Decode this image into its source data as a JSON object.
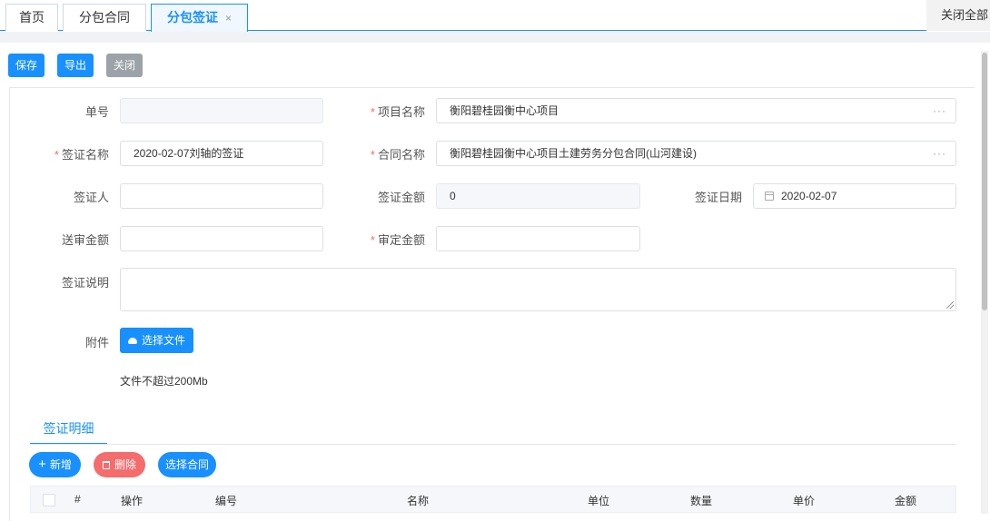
{
  "tabs": [
    {
      "label": "首页"
    },
    {
      "label": "分包合同"
    },
    {
      "label": "分包签证",
      "close": "×"
    }
  ],
  "close_all": "关闭全部",
  "toolbar": {
    "save": "保存",
    "export": "导出",
    "close": "关闭"
  },
  "form": {
    "order_no": {
      "label": "单号",
      "value": ""
    },
    "project_name": {
      "label": "项目名称",
      "required": "*",
      "value": "衡阳碧桂园衡中心项目",
      "more": "···"
    },
    "visa_name": {
      "label": "签证名称",
      "required": "*",
      "value": "2020-02-07刘轴的签证"
    },
    "contract_name": {
      "label": "合同名称",
      "required": "*",
      "value": "衡阳碧桂园衡中心项目土建劳务分包合同(山河建设)",
      "more": "···"
    },
    "visa_person": {
      "label": "签证人",
      "value": ""
    },
    "visa_amount": {
      "label": "签证金额",
      "value": "0"
    },
    "visa_date": {
      "label": "签证日期",
      "value": "2020-02-07"
    },
    "submit_amount": {
      "label": "送审金额",
      "value": ""
    },
    "approved_amount": {
      "label": "审定金额",
      "required": "*",
      "value": ""
    },
    "description": {
      "label": "签证说明",
      "value": ""
    },
    "attachment": {
      "label": "附件",
      "button": "选择文件",
      "hint": "文件不超过200Mb"
    }
  },
  "detail": {
    "tab": "签证明细",
    "actions": {
      "add": "新增",
      "delete": "删除",
      "select_contract": "选择合同"
    },
    "columns": [
      "#",
      "操作",
      "编号",
      "名称",
      "单位",
      "数量",
      "单价",
      "金额"
    ]
  },
  "icons": {
    "calendar": "calendar-icon",
    "cloud": "cloud-upload-icon",
    "plus": "plus-icon",
    "trash": "trash-icon"
  },
  "colors": {
    "primary": "#1890ff",
    "danger": "#f56c6c",
    "disabled": "#9ca3a8"
  }
}
